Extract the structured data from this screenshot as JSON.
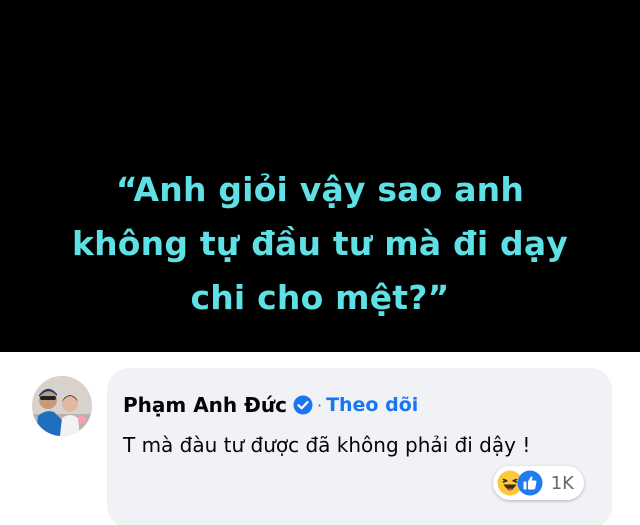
{
  "quote": {
    "lines": [
      "“Anh giỏi vậy sao anh",
      "không tự đầu tư mà đi dạy",
      "chi cho mệt?”"
    ]
  },
  "comment": {
    "author": "Phạm Anh Đức",
    "separator": "·",
    "follow_label": "Theo dõi",
    "text": "T mà đàu tư được đã không phải đi dậy !",
    "reaction_icons": [
      "haha-reaction-icon",
      "like-reaction-icon"
    ],
    "reaction_count": "1K"
  },
  "colors": {
    "background": "#000000",
    "quote_text": "#5fe0e4",
    "bubble": "#f0f2f5",
    "link": "#1876f2",
    "verified": "#1876f2"
  }
}
